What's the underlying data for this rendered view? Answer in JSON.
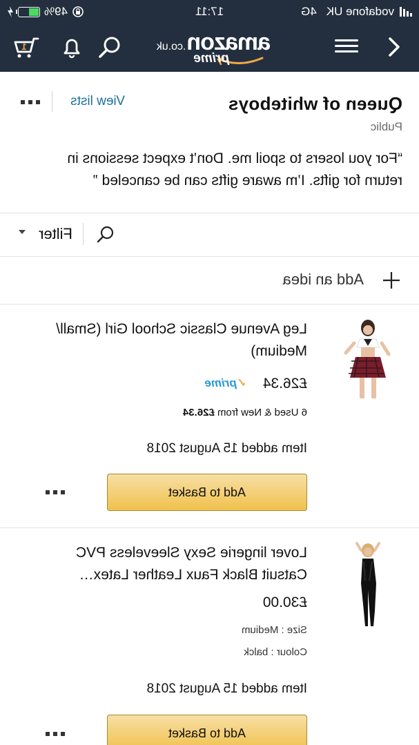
{
  "status_bar": {
    "carrier": "vodafone UK",
    "network": "4G",
    "time": "17:11",
    "battery": "49%"
  },
  "header": {
    "logo_word": "amazon",
    "logo_tld": ".co.uk",
    "logo_prime": "prime"
  },
  "list": {
    "title": "Queen of whiteboys",
    "privacy": "Public",
    "description": "“For you losers to spoil me. Don’t expect sessions in return for gifts. I’m aware gifts can be canceled ”",
    "view_lists_label": "View lists"
  },
  "filter": {
    "label": "Filter"
  },
  "add_idea": {
    "label": "Add an idea"
  },
  "items": [
    {
      "title": "Leg Avenue Classic School Girl (Small/ Medium)",
      "price": "£26.34",
      "prime": "prime",
      "offers_prefix": "6 Used & New from ",
      "offers_price": "£26.34",
      "date_added": "Item added 15 August 2018",
      "basket_label": "Add to Basket"
    },
    {
      "title": "Lover lingerie Sexy Sleeveless PVC Catsuit Black Faux Leather Latex…",
      "price": "£30.00",
      "size": "Size : Medium",
      "colour": "Colour : balck",
      "date_added": "Item added 15 August 2018",
      "basket_label": "Add to Basket"
    }
  ],
  "colors": {
    "header_bg": "#232f3e",
    "link": "#1a6fa0",
    "prime_blue": "#2a9bd6",
    "basket_gold": "#f0c14b"
  }
}
